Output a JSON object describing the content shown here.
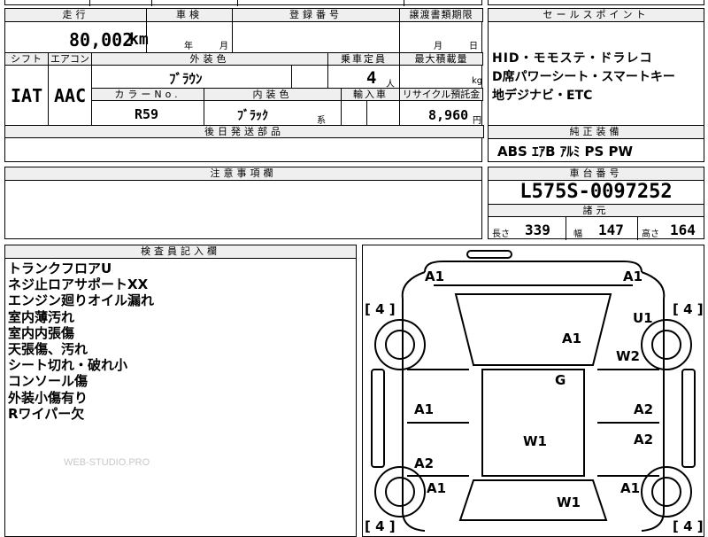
{
  "top_strip": {
    "partial_text_1": "国 庁 ポ",
    "partial_text_2": "リ"
  },
  "mileage": {
    "header": "走行",
    "value": "80,002",
    "unit": "km"
  },
  "inspection": {
    "header": "車検",
    "year_label": "年",
    "month_label": "月"
  },
  "registration": {
    "header": "登録番号",
    "value": ""
  },
  "transfer_deadline": {
    "header": "譲渡書類期限",
    "month_label": "月",
    "day_label": "日"
  },
  "shift": {
    "header": "シフト",
    "value": "IAT"
  },
  "aircon": {
    "header": "エアコン",
    "value": "AAC"
  },
  "exterior_color": {
    "header": "外装色",
    "value": "ﾌﾞﾗｳﾝ"
  },
  "color_no": {
    "header": "カラーNo.",
    "value": "R59"
  },
  "interior_color": {
    "header": "内装色",
    "value": "ﾌﾞﾗｯｸ",
    "suffix": "系"
  },
  "capacity": {
    "header": "乗車定員",
    "value": "4",
    "unit": "人"
  },
  "max_load": {
    "header": "最大積載量",
    "unit": "kg"
  },
  "import": {
    "header": "輸入車",
    "value": ""
  },
  "recycle": {
    "header": "リサイクル預託金",
    "value": "8,960",
    "unit": "円"
  },
  "later_parts": {
    "header": "後日発送部品",
    "value": ""
  },
  "sales_points": {
    "header": "セールスポイント",
    "lines": [
      "HID・モモステ・ドラレコ",
      "D席パワーシート・スマートキー",
      "地デジナビ・ETC"
    ]
  },
  "genuine_equipment": {
    "header": "純正装備",
    "value": "ABS ｴｱB ｱﾙﾐ PS PW"
  },
  "notes": {
    "header": "注意事項欄",
    "value": ""
  },
  "chassis": {
    "header": "車台番号",
    "value": "L575S-0097252"
  },
  "specs": {
    "header": "諸元",
    "length_label": "長さ",
    "length": "339",
    "width_label": "幅",
    "width": "147",
    "height_label": "高さ",
    "height": "164"
  },
  "inspector_memo": {
    "header": "検査員記入欄",
    "lines": [
      "トランクフロアU",
      "ネジ止ロアサポートXX",
      "エンジン廻りオイル漏れ",
      "室内薄汚れ",
      "室内内張傷",
      "天張傷、汚れ",
      "シート切れ・破れ小",
      "コンソール傷",
      "外装小傷有り",
      "Rワイパー欠"
    ],
    "watermark": "WEB-STUDIO.PRO"
  },
  "diagram": {
    "tire_labels": [
      "[ 4 ]",
      "[ 4 ]",
      "[ 4 ]",
      "[ 4 ]"
    ],
    "marks": [
      "A1",
      "A1",
      "U1",
      "A1",
      "W2",
      "G",
      "A1",
      "A2",
      "W1",
      "A2",
      "A2",
      "A1",
      "A1",
      "W1"
    ]
  }
}
